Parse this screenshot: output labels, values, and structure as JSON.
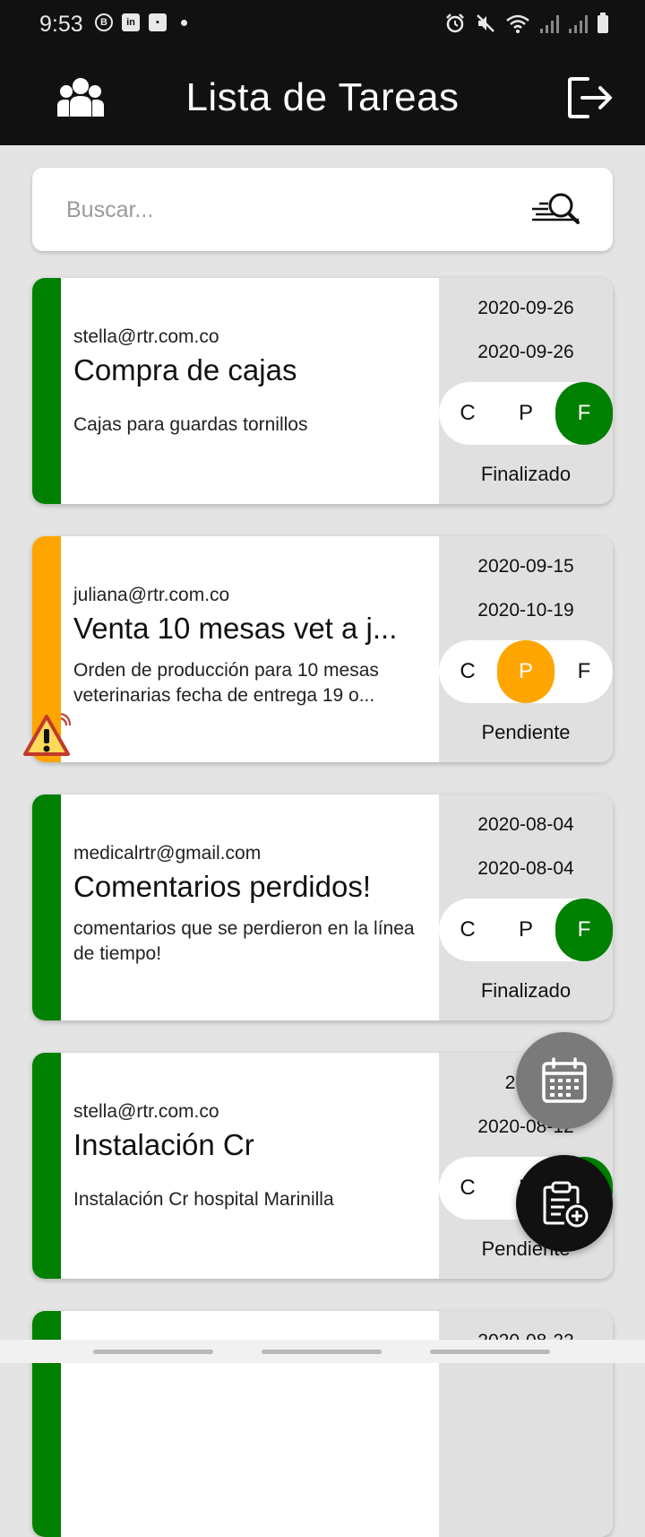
{
  "status_bar": {
    "time": "9:53",
    "left_icons": [
      "b-icon",
      "linkedin-icon",
      "download-icon",
      "dot-icon"
    ],
    "right_icons": [
      "alarm-icon",
      "mute-icon",
      "wifi-icon",
      "signal-icon",
      "signal-icon",
      "battery-icon"
    ]
  },
  "app_bar": {
    "title": "Lista de Tareas",
    "left_icon": "team-icon",
    "right_icon": "logout-icon"
  },
  "search": {
    "placeholder": "Buscar...",
    "value": "",
    "icon": "search-list-icon"
  },
  "tasks": [
    {
      "email": "stella@rtr.com.co",
      "title": "Compra de cajas",
      "description": "Cajas para guardas tornillos",
      "start_date": "2020-09-26",
      "end_date": "2020-09-26",
      "options": [
        "C",
        "P",
        "F"
      ],
      "active_option": "F",
      "status": "Finalizado",
      "color": "#008000"
    },
    {
      "email": "juliana@rtr.com.co",
      "title": "Venta 10 mesas vet a j...",
      "description": "Orden de producción para 10 mesas veterinarias fecha de entrega 19 o...",
      "start_date": "2020-09-15",
      "end_date": "2020-10-19",
      "options": [
        "C",
        "P",
        "F"
      ],
      "active_option": "P",
      "status": "Pendiente",
      "color": "#FFA500",
      "alert_icon": "warning-icon"
    },
    {
      "email": "medicalrtr@gmail.com",
      "title": "Comentarios perdidos!",
      "description": "comentarios que se perdieron en la línea de tiempo!",
      "start_date": "2020-08-04",
      "end_date": "2020-08-04",
      "options": [
        "C",
        "P",
        "F"
      ],
      "active_option": "F",
      "status": "Finalizado",
      "color": "#008000"
    },
    {
      "email": "stella@rtr.com.co",
      "title": "Instalación Cr",
      "description": "Instalación Cr hospital Marinilla",
      "start_date": "2020",
      "end_date": "2020-08-12",
      "options": [
        "C",
        "P",
        "F"
      ],
      "active_option": "F",
      "status": "Pendiente",
      "color": "#008000"
    },
    {
      "email": "",
      "title": "",
      "description": "",
      "start_date": "2020-08-22",
      "end_date": "",
      "options": [],
      "active_option": "",
      "status": "",
      "color": "#008000"
    }
  ],
  "fabs": {
    "calendar_icon": "calendar-icon",
    "add_icon": "add-task-icon"
  }
}
